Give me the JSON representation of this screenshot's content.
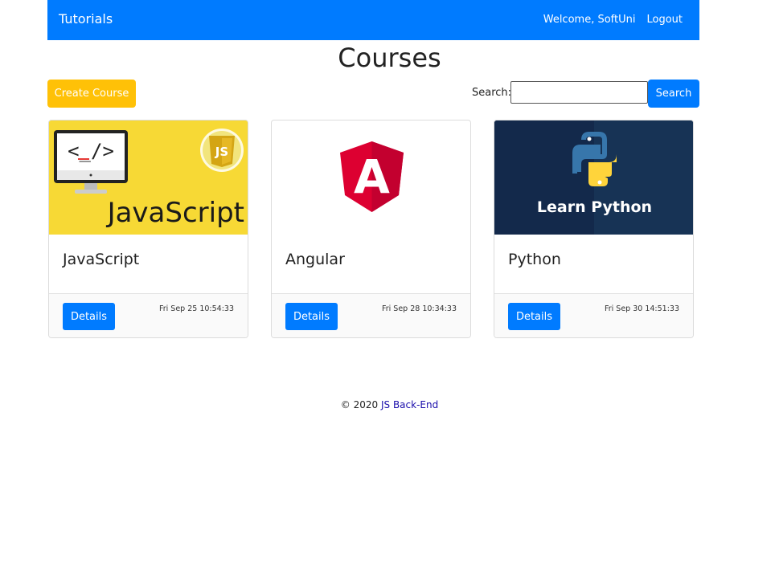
{
  "navbar": {
    "brand": "Tutorials",
    "welcome": "Welcome, SoftUni",
    "logout": "Logout",
    "color": "#007bff"
  },
  "page_title": "Courses",
  "toolbar": {
    "create_label": "Create Course",
    "search_label": "Search:",
    "search_value": "",
    "search_button": "Search"
  },
  "courses": [
    {
      "title": "JavaScript",
      "image": "javascript-image",
      "image_text": "JavaScript",
      "image_code": "<_/>",
      "badge": "JS",
      "details_label": "Details",
      "date": "Fri Sep 25 10:54:33"
    },
    {
      "title": "Angular",
      "image": "angular-logo",
      "image_text": "A",
      "details_label": "Details",
      "date": "Fri Sep 28 10:34:33"
    },
    {
      "title": "Python",
      "image": "python-image",
      "image_text": "Learn Python",
      "details_label": "Details",
      "date": "Fri Sep 30 14:51:33"
    }
  ],
  "footer": {
    "copyright": "© 2020",
    "link_text": "JS Back-End"
  },
  "colors": {
    "primary": "#007bff",
    "warning": "#ffc107",
    "js_yellow": "#f7d935",
    "angular_red": "#dd0031",
    "python_navy": "#13294b"
  }
}
